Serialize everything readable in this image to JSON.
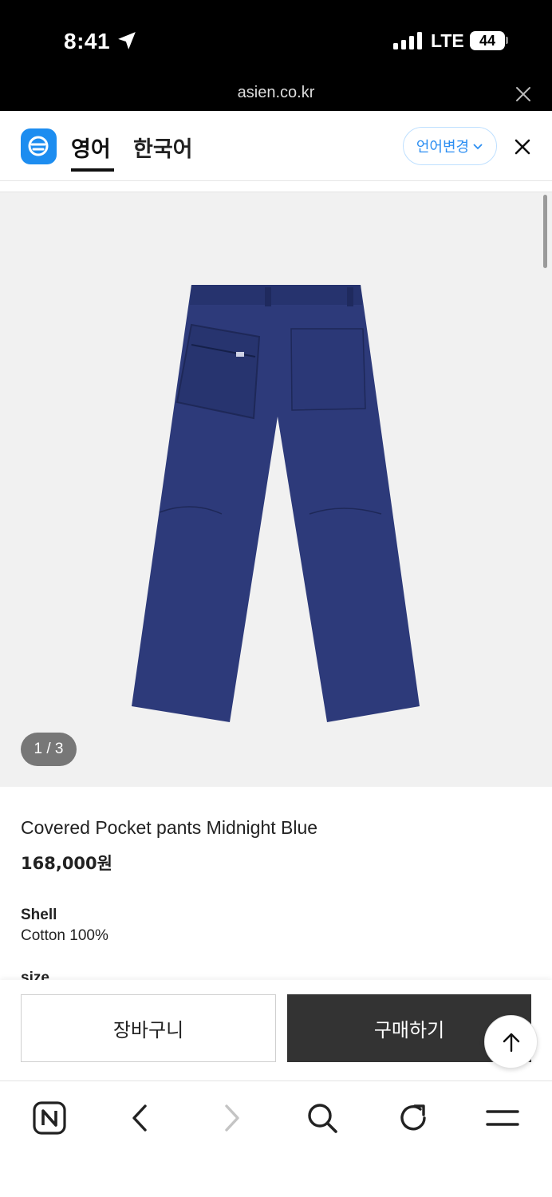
{
  "status_bar": {
    "time": "8:41",
    "network": "LTE",
    "battery": "44",
    "url": "asien.co.kr"
  },
  "translate_bar": {
    "tab_active": "영어",
    "tab_inactive": "한국어",
    "language_change": "언어변경"
  },
  "gallery": {
    "counter": "1 / 3",
    "product_color": "#2d3a7a"
  },
  "product": {
    "title": "Covered Pocket pants Midnight Blue",
    "price": "168,000원",
    "spec_label": "Shell",
    "spec_value": "Cotton 100%",
    "size_label": "size"
  },
  "actions": {
    "cart_label": "장바구니",
    "buy_label": "구매하기"
  },
  "browser_toolbar": {
    "icons": [
      "naver-icon",
      "back-icon",
      "forward-icon",
      "search-icon",
      "refresh-icon",
      "menu-icon"
    ]
  }
}
